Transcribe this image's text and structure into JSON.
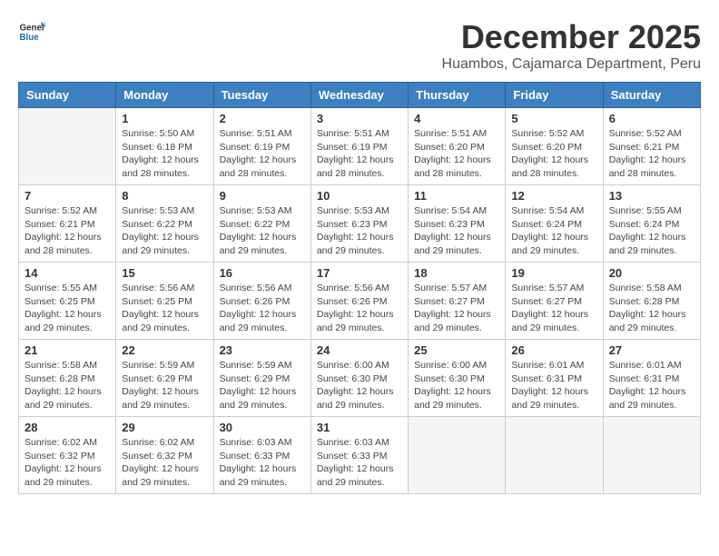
{
  "logo": {
    "general": "General",
    "blue": "Blue"
  },
  "title": "December 2025",
  "subtitle": "Huambos, Cajamarca Department, Peru",
  "headers": [
    "Sunday",
    "Monday",
    "Tuesday",
    "Wednesday",
    "Thursday",
    "Friday",
    "Saturday"
  ],
  "weeks": [
    [
      {
        "day": "",
        "content": ""
      },
      {
        "day": "1",
        "content": "Sunrise: 5:50 AM\nSunset: 6:18 PM\nDaylight: 12 hours\nand 28 minutes."
      },
      {
        "day": "2",
        "content": "Sunrise: 5:51 AM\nSunset: 6:19 PM\nDaylight: 12 hours\nand 28 minutes."
      },
      {
        "day": "3",
        "content": "Sunrise: 5:51 AM\nSunset: 6:19 PM\nDaylight: 12 hours\nand 28 minutes."
      },
      {
        "day": "4",
        "content": "Sunrise: 5:51 AM\nSunset: 6:20 PM\nDaylight: 12 hours\nand 28 minutes."
      },
      {
        "day": "5",
        "content": "Sunrise: 5:52 AM\nSunset: 6:20 PM\nDaylight: 12 hours\nand 28 minutes."
      },
      {
        "day": "6",
        "content": "Sunrise: 5:52 AM\nSunset: 6:21 PM\nDaylight: 12 hours\nand 28 minutes."
      }
    ],
    [
      {
        "day": "7",
        "content": "Sunrise: 5:52 AM\nSunset: 6:21 PM\nDaylight: 12 hours\nand 28 minutes."
      },
      {
        "day": "8",
        "content": "Sunrise: 5:53 AM\nSunset: 6:22 PM\nDaylight: 12 hours\nand 29 minutes."
      },
      {
        "day": "9",
        "content": "Sunrise: 5:53 AM\nSunset: 6:22 PM\nDaylight: 12 hours\nand 29 minutes."
      },
      {
        "day": "10",
        "content": "Sunrise: 5:53 AM\nSunset: 6:23 PM\nDaylight: 12 hours\nand 29 minutes."
      },
      {
        "day": "11",
        "content": "Sunrise: 5:54 AM\nSunset: 6:23 PM\nDaylight: 12 hours\nand 29 minutes."
      },
      {
        "day": "12",
        "content": "Sunrise: 5:54 AM\nSunset: 6:24 PM\nDaylight: 12 hours\nand 29 minutes."
      },
      {
        "day": "13",
        "content": "Sunrise: 5:55 AM\nSunset: 6:24 PM\nDaylight: 12 hours\nand 29 minutes."
      }
    ],
    [
      {
        "day": "14",
        "content": "Sunrise: 5:55 AM\nSunset: 6:25 PM\nDaylight: 12 hours\nand 29 minutes."
      },
      {
        "day": "15",
        "content": "Sunrise: 5:56 AM\nSunset: 6:25 PM\nDaylight: 12 hours\nand 29 minutes."
      },
      {
        "day": "16",
        "content": "Sunrise: 5:56 AM\nSunset: 6:26 PM\nDaylight: 12 hours\nand 29 minutes."
      },
      {
        "day": "17",
        "content": "Sunrise: 5:56 AM\nSunset: 6:26 PM\nDaylight: 12 hours\nand 29 minutes."
      },
      {
        "day": "18",
        "content": "Sunrise: 5:57 AM\nSunset: 6:27 PM\nDaylight: 12 hours\nand 29 minutes."
      },
      {
        "day": "19",
        "content": "Sunrise: 5:57 AM\nSunset: 6:27 PM\nDaylight: 12 hours\nand 29 minutes."
      },
      {
        "day": "20",
        "content": "Sunrise: 5:58 AM\nSunset: 6:28 PM\nDaylight: 12 hours\nand 29 minutes."
      }
    ],
    [
      {
        "day": "21",
        "content": "Sunrise: 5:58 AM\nSunset: 6:28 PM\nDaylight: 12 hours\nand 29 minutes."
      },
      {
        "day": "22",
        "content": "Sunrise: 5:59 AM\nSunset: 6:29 PM\nDaylight: 12 hours\nand 29 minutes."
      },
      {
        "day": "23",
        "content": "Sunrise: 5:59 AM\nSunset: 6:29 PM\nDaylight: 12 hours\nand 29 minutes."
      },
      {
        "day": "24",
        "content": "Sunrise: 6:00 AM\nSunset: 6:30 PM\nDaylight: 12 hours\nand 29 minutes."
      },
      {
        "day": "25",
        "content": "Sunrise: 6:00 AM\nSunset: 6:30 PM\nDaylight: 12 hours\nand 29 minutes."
      },
      {
        "day": "26",
        "content": "Sunrise: 6:01 AM\nSunset: 6:31 PM\nDaylight: 12 hours\nand 29 minutes."
      },
      {
        "day": "27",
        "content": "Sunrise: 6:01 AM\nSunset: 6:31 PM\nDaylight: 12 hours\nand 29 minutes."
      }
    ],
    [
      {
        "day": "28",
        "content": "Sunrise: 6:02 AM\nSunset: 6:32 PM\nDaylight: 12 hours\nand 29 minutes."
      },
      {
        "day": "29",
        "content": "Sunrise: 6:02 AM\nSunset: 6:32 PM\nDaylight: 12 hours\nand 29 minutes."
      },
      {
        "day": "30",
        "content": "Sunrise: 6:03 AM\nSunset: 6:33 PM\nDaylight: 12 hours\nand 29 minutes."
      },
      {
        "day": "31",
        "content": "Sunrise: 6:03 AM\nSunset: 6:33 PM\nDaylight: 12 hours\nand 29 minutes."
      },
      {
        "day": "",
        "content": ""
      },
      {
        "day": "",
        "content": ""
      },
      {
        "day": "",
        "content": ""
      }
    ]
  ]
}
